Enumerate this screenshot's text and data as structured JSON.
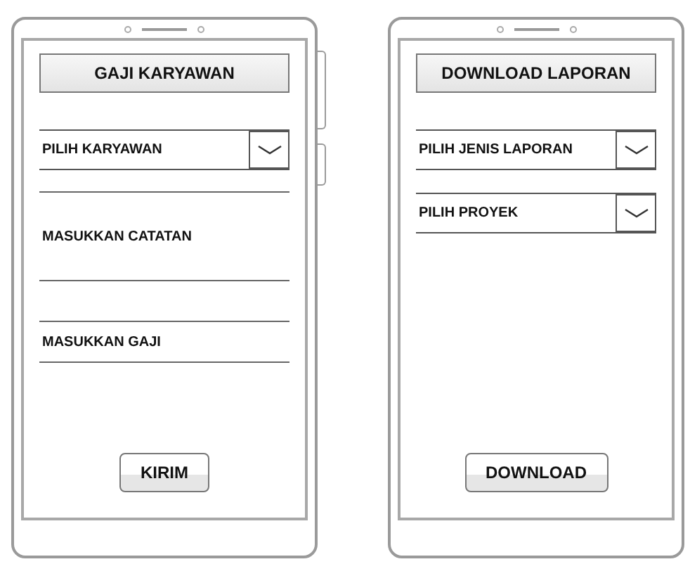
{
  "screens": [
    {
      "title": "GAJI KARYAWAN",
      "fields": [
        {
          "kind": "dropdown",
          "label": "PILIH KARYAWAN"
        },
        {
          "kind": "textarea",
          "placeholder": "MASUKKAN CATATAN"
        },
        {
          "kind": "input",
          "placeholder": "MASUKKAN GAJI"
        }
      ],
      "button": "KIRIM"
    },
    {
      "title": "DOWNLOAD LAPORAN",
      "fields": [
        {
          "kind": "dropdown",
          "label": "PILIH JENIS LAPORAN"
        },
        {
          "kind": "dropdown",
          "label": "PILIH PROYEK"
        }
      ],
      "button": "DOWNLOAD"
    }
  ]
}
